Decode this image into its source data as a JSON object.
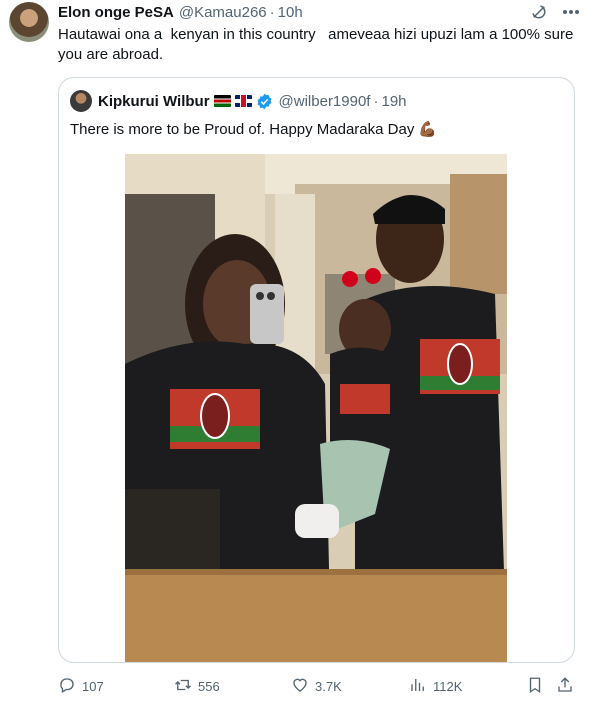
{
  "tweet": {
    "author_name": "Elon onge PeSA",
    "author_handle": "@Kamau266",
    "separator": "·",
    "time": "10h",
    "text": "Hautawai ona a  kenyan in this country   ameveaa hizi upuzi lam a 100% sure you are abroad."
  },
  "quote": {
    "author_name": "Kipkurui Wilbur",
    "flags": [
      "kenya-flag",
      "uk-flag"
    ],
    "verified": true,
    "author_handle": "@wilber1990f",
    "separator": "·",
    "time": "19h",
    "text": "There is more to be Proud of. Happy Madaraka Day",
    "emoji": "💪🏾",
    "image_alt": "Photo of a family of three in a mirror selfie wearing black Kenya t-shirts"
  },
  "actions": {
    "replies": "107",
    "reposts": "556",
    "likes": "3.7K",
    "views": "112K"
  },
  "icons": {
    "header": [
      "grok-icon",
      "more-icon"
    ],
    "actions": [
      "reply-icon",
      "repost-icon",
      "like-icon",
      "views-icon",
      "bookmark-icon",
      "share-icon"
    ]
  },
  "colors": {
    "text": "#0f1419",
    "secondary": "#536471",
    "border": "#cfd9de",
    "verified": "#1d9bf0"
  }
}
